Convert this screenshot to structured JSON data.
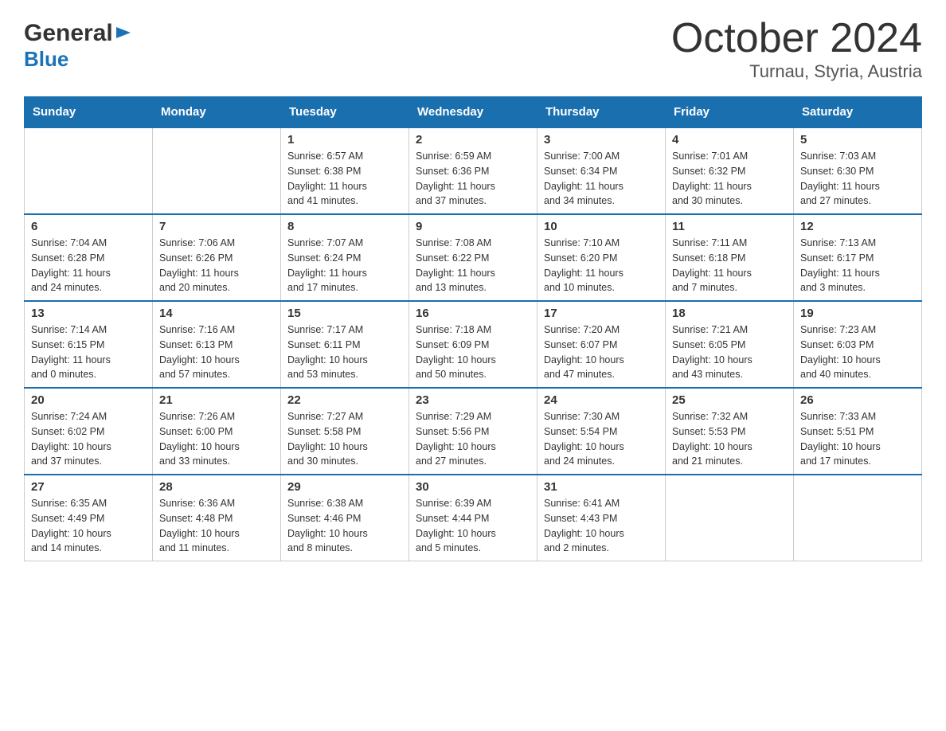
{
  "header": {
    "logo_general": "General",
    "logo_blue": "Blue",
    "month_title": "October 2024",
    "location": "Turnau, Styria, Austria"
  },
  "days_of_week": [
    "Sunday",
    "Monday",
    "Tuesday",
    "Wednesday",
    "Thursday",
    "Friday",
    "Saturday"
  ],
  "weeks": [
    [
      {
        "day": "",
        "info": ""
      },
      {
        "day": "",
        "info": ""
      },
      {
        "day": "1",
        "info": "Sunrise: 6:57 AM\nSunset: 6:38 PM\nDaylight: 11 hours\nand 41 minutes."
      },
      {
        "day": "2",
        "info": "Sunrise: 6:59 AM\nSunset: 6:36 PM\nDaylight: 11 hours\nand 37 minutes."
      },
      {
        "day": "3",
        "info": "Sunrise: 7:00 AM\nSunset: 6:34 PM\nDaylight: 11 hours\nand 34 minutes."
      },
      {
        "day": "4",
        "info": "Sunrise: 7:01 AM\nSunset: 6:32 PM\nDaylight: 11 hours\nand 30 minutes."
      },
      {
        "day": "5",
        "info": "Sunrise: 7:03 AM\nSunset: 6:30 PM\nDaylight: 11 hours\nand 27 minutes."
      }
    ],
    [
      {
        "day": "6",
        "info": "Sunrise: 7:04 AM\nSunset: 6:28 PM\nDaylight: 11 hours\nand 24 minutes."
      },
      {
        "day": "7",
        "info": "Sunrise: 7:06 AM\nSunset: 6:26 PM\nDaylight: 11 hours\nand 20 minutes."
      },
      {
        "day": "8",
        "info": "Sunrise: 7:07 AM\nSunset: 6:24 PM\nDaylight: 11 hours\nand 17 minutes."
      },
      {
        "day": "9",
        "info": "Sunrise: 7:08 AM\nSunset: 6:22 PM\nDaylight: 11 hours\nand 13 minutes."
      },
      {
        "day": "10",
        "info": "Sunrise: 7:10 AM\nSunset: 6:20 PM\nDaylight: 11 hours\nand 10 minutes."
      },
      {
        "day": "11",
        "info": "Sunrise: 7:11 AM\nSunset: 6:18 PM\nDaylight: 11 hours\nand 7 minutes."
      },
      {
        "day": "12",
        "info": "Sunrise: 7:13 AM\nSunset: 6:17 PM\nDaylight: 11 hours\nand 3 minutes."
      }
    ],
    [
      {
        "day": "13",
        "info": "Sunrise: 7:14 AM\nSunset: 6:15 PM\nDaylight: 11 hours\nand 0 minutes."
      },
      {
        "day": "14",
        "info": "Sunrise: 7:16 AM\nSunset: 6:13 PM\nDaylight: 10 hours\nand 57 minutes."
      },
      {
        "day": "15",
        "info": "Sunrise: 7:17 AM\nSunset: 6:11 PM\nDaylight: 10 hours\nand 53 minutes."
      },
      {
        "day": "16",
        "info": "Sunrise: 7:18 AM\nSunset: 6:09 PM\nDaylight: 10 hours\nand 50 minutes."
      },
      {
        "day": "17",
        "info": "Sunrise: 7:20 AM\nSunset: 6:07 PM\nDaylight: 10 hours\nand 47 minutes."
      },
      {
        "day": "18",
        "info": "Sunrise: 7:21 AM\nSunset: 6:05 PM\nDaylight: 10 hours\nand 43 minutes."
      },
      {
        "day": "19",
        "info": "Sunrise: 7:23 AM\nSunset: 6:03 PM\nDaylight: 10 hours\nand 40 minutes."
      }
    ],
    [
      {
        "day": "20",
        "info": "Sunrise: 7:24 AM\nSunset: 6:02 PM\nDaylight: 10 hours\nand 37 minutes."
      },
      {
        "day": "21",
        "info": "Sunrise: 7:26 AM\nSunset: 6:00 PM\nDaylight: 10 hours\nand 33 minutes."
      },
      {
        "day": "22",
        "info": "Sunrise: 7:27 AM\nSunset: 5:58 PM\nDaylight: 10 hours\nand 30 minutes."
      },
      {
        "day": "23",
        "info": "Sunrise: 7:29 AM\nSunset: 5:56 PM\nDaylight: 10 hours\nand 27 minutes."
      },
      {
        "day": "24",
        "info": "Sunrise: 7:30 AM\nSunset: 5:54 PM\nDaylight: 10 hours\nand 24 minutes."
      },
      {
        "day": "25",
        "info": "Sunrise: 7:32 AM\nSunset: 5:53 PM\nDaylight: 10 hours\nand 21 minutes."
      },
      {
        "day": "26",
        "info": "Sunrise: 7:33 AM\nSunset: 5:51 PM\nDaylight: 10 hours\nand 17 minutes."
      }
    ],
    [
      {
        "day": "27",
        "info": "Sunrise: 6:35 AM\nSunset: 4:49 PM\nDaylight: 10 hours\nand 14 minutes."
      },
      {
        "day": "28",
        "info": "Sunrise: 6:36 AM\nSunset: 4:48 PM\nDaylight: 10 hours\nand 11 minutes."
      },
      {
        "day": "29",
        "info": "Sunrise: 6:38 AM\nSunset: 4:46 PM\nDaylight: 10 hours\nand 8 minutes."
      },
      {
        "day": "30",
        "info": "Sunrise: 6:39 AM\nSunset: 4:44 PM\nDaylight: 10 hours\nand 5 minutes."
      },
      {
        "day": "31",
        "info": "Sunrise: 6:41 AM\nSunset: 4:43 PM\nDaylight: 10 hours\nand 2 minutes."
      },
      {
        "day": "",
        "info": ""
      },
      {
        "day": "",
        "info": ""
      }
    ]
  ]
}
